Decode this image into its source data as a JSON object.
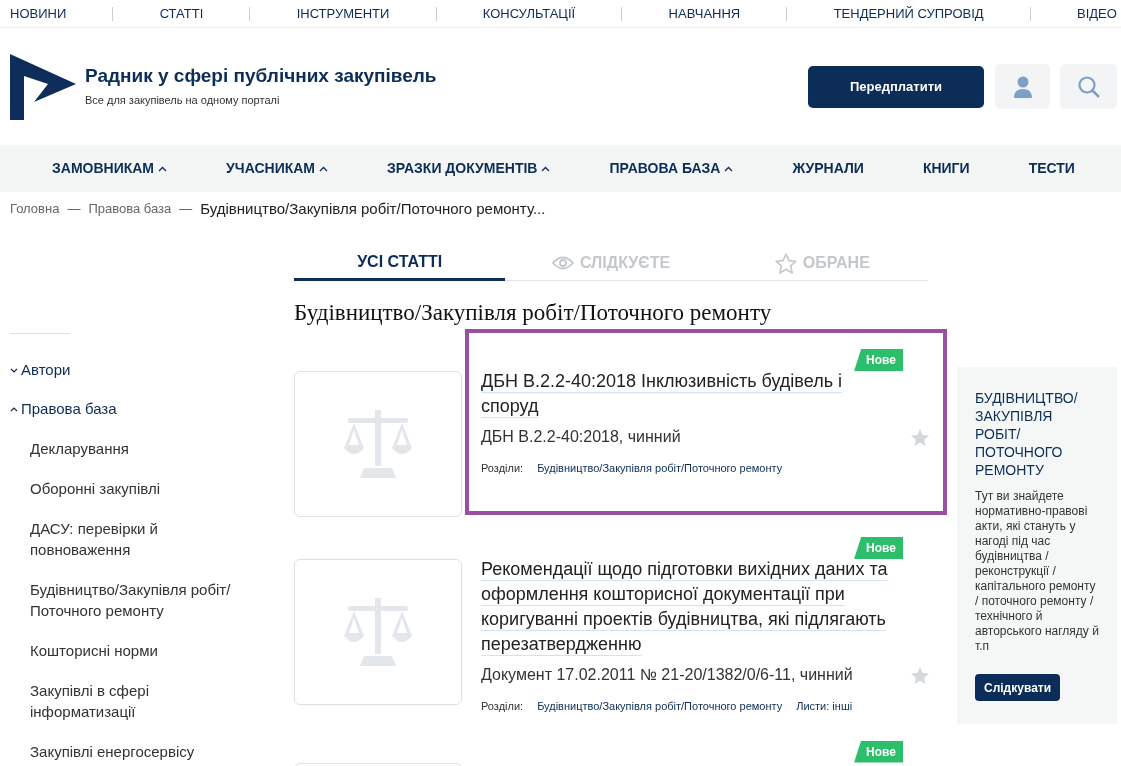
{
  "top_nav": [
    "НОВИНИ",
    "СТАТТІ",
    "ІНСТРУМЕНТИ",
    "КОНСУЛЬТАЦІЇ",
    "НАВЧАННЯ",
    "ТЕНДЕРНИЙ СУПРОВІД",
    "ВІДЕО"
  ],
  "header": {
    "title": "Радник у сфері публічних закупівель",
    "subtitle": "Все для закупівель на одному порталі",
    "subscribe_button": "Передплатити"
  },
  "main_nav": [
    {
      "label": "ЗАМОВНИКАМ",
      "dropdown": true
    },
    {
      "label": "УЧАСНИКАМ",
      "dropdown": true
    },
    {
      "label": "ЗРАЗКИ ДОКУМЕНТІВ",
      "dropdown": true
    },
    {
      "label": "ПРАВОВА БАЗА",
      "dropdown": true
    },
    {
      "label": "ЖУРНАЛИ",
      "dropdown": false
    },
    {
      "label": "КНИГИ",
      "dropdown": false
    },
    {
      "label": "ТЕСТИ",
      "dropdown": false
    }
  ],
  "breadcrumb_separator": "—",
  "breadcrumbs": [
    "Головна",
    "Правова база",
    "Будівництво/Закупівля робіт/Поточного ремонту..."
  ],
  "sidebar": {
    "items": [
      {
        "label": "Автори",
        "expanded": false
      },
      {
        "label": "Правова база",
        "expanded": true,
        "children": [
          {
            "label": "Декларування"
          },
          {
            "label": "Оборонні закупівлі"
          },
          {
            "label": "ДАСУ: перевірки й повноваження"
          },
          {
            "label": "Будівництво/Закупівля робіт/ Поточного ремонту"
          },
          {
            "label": "Кошторисні норми"
          },
          {
            "label": "Закупівлі в сфері інформатизації"
          },
          {
            "label": "Закупівлі енергосервісу"
          }
        ]
      }
    ]
  },
  "tabs": [
    {
      "label": "УСІ СТАТТІ",
      "kind": "all",
      "selected": true
    },
    {
      "label": "СЛІДКУЄТЕ",
      "kind": "watch",
      "selected": false
    },
    {
      "label": "ОБРАНЕ",
      "kind": "favorite",
      "selected": false
    }
  ],
  "heading": "Будівництво/Закупівля робіт/Поточного ремонту",
  "articles": [
    {
      "badge": "Нове",
      "highlighted": true,
      "title": "ДБН В.2.2-40:2018 Інклюзивність будівель і споруд",
      "meta": "ДБН В.2.2-40:2018, чинний",
      "favorite": false,
      "sections_label": "Розділи:",
      "sections": [
        "Будівництво/Закупівля робіт/Поточного ремонту"
      ]
    },
    {
      "badge": "Нове",
      "highlighted": false,
      "title": "Рекомендації щодо підготовки вихідних даних та оформлення кошторисної документації при коригуванні проектів будівництва, які підлягають перезатвердженню",
      "meta": "Документ 17.02.2011 № 21-20/1382/0/6-11, чинний",
      "favorite": false,
      "sections_label": "Розділи:",
      "sections": [
        "Будівництво/Закупівля робіт/Поточного ремонту",
        "Листи: інші"
      ]
    },
    {
      "badge": "Нове",
      "highlighted": false
    }
  ],
  "side_panel": {
    "title": "БУДІВНИЦТВО/ ЗАКУПІВЛЯ РОБІТ/ ПОТОЧНОГО РЕМОНТУ",
    "text": "Тут ви знайдете нормативно-правові акти, які стануть у нагоді під час будівництва / реконструкції / капітального ремонту / поточного ремонту / технічного й авторського нагляду й т.п",
    "button": "Слідкувати"
  }
}
